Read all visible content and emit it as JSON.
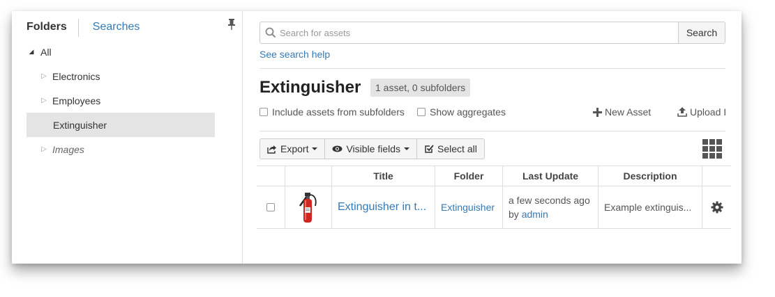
{
  "left_panel": {
    "tabs": {
      "folders": "Folders",
      "searches": "Searches"
    },
    "tree": {
      "root": "All",
      "items": [
        {
          "label": "Electronics"
        },
        {
          "label": "Employees"
        },
        {
          "label": "Extinguisher",
          "selected": true
        },
        {
          "label": "Images",
          "italic": true
        }
      ]
    }
  },
  "search": {
    "placeholder": "Search for assets",
    "value": "",
    "button": "Search",
    "help_link": "See search help"
  },
  "folder": {
    "title": "Extinguisher",
    "count": "1 asset, 0 subfolders"
  },
  "options": {
    "include_subfolders": "Include assets from subfolders",
    "show_aggregates": "Show aggregates"
  },
  "actions": {
    "new_asset": "New Asset",
    "upload": "Upload I"
  },
  "toolbar": {
    "export": "Export",
    "visible_fields": "Visible fields",
    "select_all": "Select all"
  },
  "table": {
    "headers": {
      "title": "Title",
      "folder": "Folder",
      "last_update": "Last Update",
      "description": "Description"
    },
    "rows": [
      {
        "title": "Extinguisher in t...",
        "folder": "Extinguisher",
        "last_update_prefix": "a few seconds ago",
        "last_update_by": "by",
        "last_update_user": "admin",
        "description": "Example extinguis..."
      }
    ]
  },
  "colors": {
    "link": "#337ab7",
    "selected_bg": "#e4e4e4",
    "extinguisher_red": "#d0261f"
  },
  "icons": [
    "pin-icon",
    "search-icon",
    "plus-icon",
    "upload-icon",
    "export-icon",
    "eye-icon",
    "check-square-icon",
    "grid-view-icon",
    "gear-icon",
    "extinguisher-thumbnail"
  ]
}
